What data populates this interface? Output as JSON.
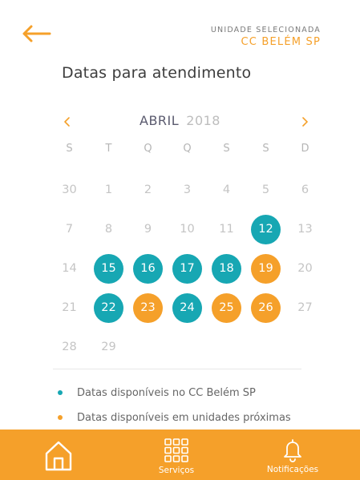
{
  "header": {
    "back_icon": "arrow-left-icon",
    "unit_label": "UNIDADE SELECIONADA",
    "unit_name": "CC BELÉM SP"
  },
  "page_title": "Datas para atendimento",
  "calendar": {
    "month": "ABRIL",
    "year": "2018",
    "prev_icon": "chevron-left-icon",
    "next_icon": "chevron-right-icon",
    "weekdays": [
      "S",
      "T",
      "Q",
      "Q",
      "S",
      "S",
      "D"
    ],
    "weeks": [
      [
        {
          "d": "30",
          "s": "muted"
        },
        {
          "d": "1",
          "s": "muted"
        },
        {
          "d": "2",
          "s": "muted"
        },
        {
          "d": "3",
          "s": "muted"
        },
        {
          "d": "4",
          "s": "muted"
        },
        {
          "d": "5",
          "s": "muted"
        },
        {
          "d": "6",
          "s": "muted"
        }
      ],
      [
        {
          "d": "7",
          "s": "muted"
        },
        {
          "d": "8",
          "s": "muted"
        },
        {
          "d": "9",
          "s": "muted"
        },
        {
          "d": "10",
          "s": "muted"
        },
        {
          "d": "11",
          "s": "muted"
        },
        {
          "d": "12",
          "s": "teal"
        },
        {
          "d": "13",
          "s": "muted"
        }
      ],
      [
        {
          "d": "14",
          "s": "muted"
        },
        {
          "d": "15",
          "s": "teal"
        },
        {
          "d": "16",
          "s": "teal"
        },
        {
          "d": "17",
          "s": "teal"
        },
        {
          "d": "18",
          "s": "teal"
        },
        {
          "d": "19",
          "s": "orange"
        },
        {
          "d": "20",
          "s": "muted"
        }
      ],
      [
        {
          "d": "21",
          "s": "muted"
        },
        {
          "d": "22",
          "s": "teal"
        },
        {
          "d": "23",
          "s": "orange"
        },
        {
          "d": "24",
          "s": "teal"
        },
        {
          "d": "25",
          "s": "orange"
        },
        {
          "d": "26",
          "s": "orange"
        },
        {
          "d": "27",
          "s": "muted"
        }
      ],
      [
        {
          "d": "28",
          "s": "muted"
        },
        {
          "d": "29",
          "s": "muted"
        }
      ]
    ]
  },
  "legend": [
    {
      "text": "Datas disponíveis no CC Belém SP",
      "color": "#17a7b3"
    },
    {
      "text": "Datas disponíveis em unidades próximas",
      "color": "#f5a02a"
    }
  ],
  "colors": {
    "accent": "#f5a02a",
    "teal": "#17a7b3"
  },
  "tabs": [
    {
      "name": "tab-home",
      "icon": "home-icon",
      "label": ""
    },
    {
      "name": "tab-services",
      "icon": "grid-icon",
      "label": "Serviços"
    },
    {
      "name": "tab-notifications",
      "icon": "bell-icon",
      "label": "Notificações"
    }
  ]
}
